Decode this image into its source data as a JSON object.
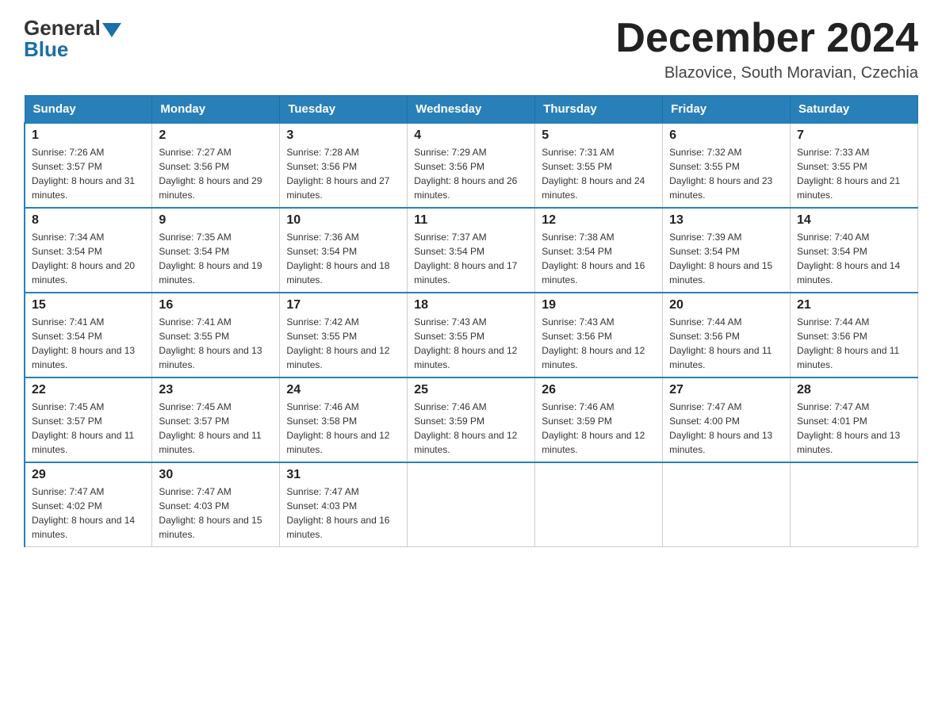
{
  "header": {
    "logo_general": "General",
    "logo_blue": "Blue",
    "month_year": "December 2024",
    "location": "Blazovice, South Moravian, Czechia"
  },
  "days_of_week": [
    "Sunday",
    "Monday",
    "Tuesday",
    "Wednesday",
    "Thursday",
    "Friday",
    "Saturday"
  ],
  "weeks": [
    [
      {
        "day": "1",
        "sunrise": "7:26 AM",
        "sunset": "3:57 PM",
        "daylight": "8 hours and 31 minutes."
      },
      {
        "day": "2",
        "sunrise": "7:27 AM",
        "sunset": "3:56 PM",
        "daylight": "8 hours and 29 minutes."
      },
      {
        "day": "3",
        "sunrise": "7:28 AM",
        "sunset": "3:56 PM",
        "daylight": "8 hours and 27 minutes."
      },
      {
        "day": "4",
        "sunrise": "7:29 AM",
        "sunset": "3:56 PM",
        "daylight": "8 hours and 26 minutes."
      },
      {
        "day": "5",
        "sunrise": "7:31 AM",
        "sunset": "3:55 PM",
        "daylight": "8 hours and 24 minutes."
      },
      {
        "day": "6",
        "sunrise": "7:32 AM",
        "sunset": "3:55 PM",
        "daylight": "8 hours and 23 minutes."
      },
      {
        "day": "7",
        "sunrise": "7:33 AM",
        "sunset": "3:55 PM",
        "daylight": "8 hours and 21 minutes."
      }
    ],
    [
      {
        "day": "8",
        "sunrise": "7:34 AM",
        "sunset": "3:54 PM",
        "daylight": "8 hours and 20 minutes."
      },
      {
        "day": "9",
        "sunrise": "7:35 AM",
        "sunset": "3:54 PM",
        "daylight": "8 hours and 19 minutes."
      },
      {
        "day": "10",
        "sunrise": "7:36 AM",
        "sunset": "3:54 PM",
        "daylight": "8 hours and 18 minutes."
      },
      {
        "day": "11",
        "sunrise": "7:37 AM",
        "sunset": "3:54 PM",
        "daylight": "8 hours and 17 minutes."
      },
      {
        "day": "12",
        "sunrise": "7:38 AM",
        "sunset": "3:54 PM",
        "daylight": "8 hours and 16 minutes."
      },
      {
        "day": "13",
        "sunrise": "7:39 AM",
        "sunset": "3:54 PM",
        "daylight": "8 hours and 15 minutes."
      },
      {
        "day": "14",
        "sunrise": "7:40 AM",
        "sunset": "3:54 PM",
        "daylight": "8 hours and 14 minutes."
      }
    ],
    [
      {
        "day": "15",
        "sunrise": "7:41 AM",
        "sunset": "3:54 PM",
        "daylight": "8 hours and 13 minutes."
      },
      {
        "day": "16",
        "sunrise": "7:41 AM",
        "sunset": "3:55 PM",
        "daylight": "8 hours and 13 minutes."
      },
      {
        "day": "17",
        "sunrise": "7:42 AM",
        "sunset": "3:55 PM",
        "daylight": "8 hours and 12 minutes."
      },
      {
        "day": "18",
        "sunrise": "7:43 AM",
        "sunset": "3:55 PM",
        "daylight": "8 hours and 12 minutes."
      },
      {
        "day": "19",
        "sunrise": "7:43 AM",
        "sunset": "3:56 PM",
        "daylight": "8 hours and 12 minutes."
      },
      {
        "day": "20",
        "sunrise": "7:44 AM",
        "sunset": "3:56 PM",
        "daylight": "8 hours and 11 minutes."
      },
      {
        "day": "21",
        "sunrise": "7:44 AM",
        "sunset": "3:56 PM",
        "daylight": "8 hours and 11 minutes."
      }
    ],
    [
      {
        "day": "22",
        "sunrise": "7:45 AM",
        "sunset": "3:57 PM",
        "daylight": "8 hours and 11 minutes."
      },
      {
        "day": "23",
        "sunrise": "7:45 AM",
        "sunset": "3:57 PM",
        "daylight": "8 hours and 11 minutes."
      },
      {
        "day": "24",
        "sunrise": "7:46 AM",
        "sunset": "3:58 PM",
        "daylight": "8 hours and 12 minutes."
      },
      {
        "day": "25",
        "sunrise": "7:46 AM",
        "sunset": "3:59 PM",
        "daylight": "8 hours and 12 minutes."
      },
      {
        "day": "26",
        "sunrise": "7:46 AM",
        "sunset": "3:59 PM",
        "daylight": "8 hours and 12 minutes."
      },
      {
        "day": "27",
        "sunrise": "7:47 AM",
        "sunset": "4:00 PM",
        "daylight": "8 hours and 13 minutes."
      },
      {
        "day": "28",
        "sunrise": "7:47 AM",
        "sunset": "4:01 PM",
        "daylight": "8 hours and 13 minutes."
      }
    ],
    [
      {
        "day": "29",
        "sunrise": "7:47 AM",
        "sunset": "4:02 PM",
        "daylight": "8 hours and 14 minutes."
      },
      {
        "day": "30",
        "sunrise": "7:47 AM",
        "sunset": "4:03 PM",
        "daylight": "8 hours and 15 minutes."
      },
      {
        "day": "31",
        "sunrise": "7:47 AM",
        "sunset": "4:03 PM",
        "daylight": "8 hours and 16 minutes."
      },
      null,
      null,
      null,
      null
    ]
  ]
}
